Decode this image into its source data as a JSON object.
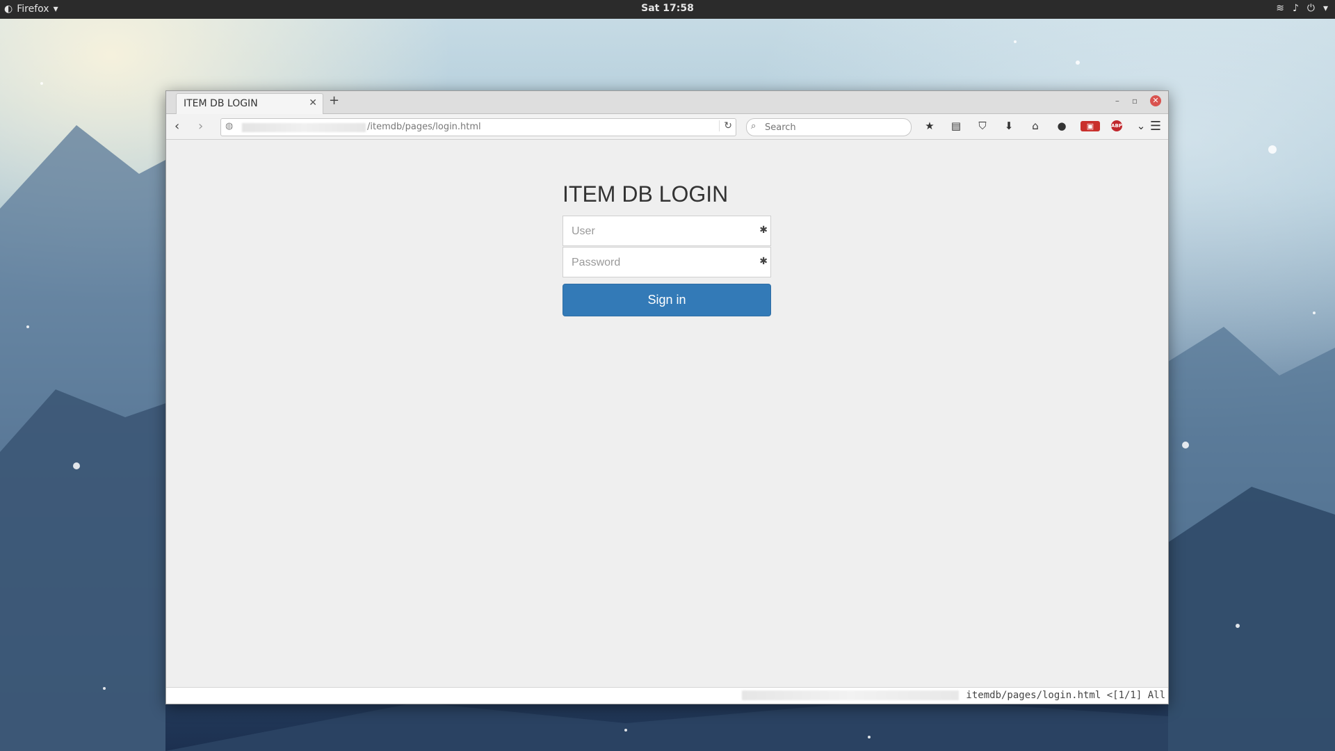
{
  "topbar": {
    "app_name": "Firefox",
    "clock": "Sat 17:58"
  },
  "browser": {
    "tab_title": "ITEM DB LOGIN",
    "url_suffix": "/itemdb/pages/login.html",
    "search_placeholder": "Search",
    "status_text": "itemdb/pages/login.html <[1/1] All"
  },
  "login": {
    "heading": "ITEM DB LOGIN",
    "user_placeholder": "User",
    "password_placeholder": "Password",
    "signin_label": "Sign in"
  },
  "colors": {
    "primary_button": "#337ab7",
    "close_button": "#d9534f"
  },
  "icons": [
    "firefox-icon",
    "wifi-icon",
    "volume-icon",
    "power-icon",
    "back-icon",
    "forward-icon",
    "globe-icon",
    "reload-icon",
    "search-icon",
    "bookmark-star-icon",
    "clipboard-icon",
    "pocket-icon",
    "download-icon",
    "home-icon",
    "chat-icon",
    "extension-icon",
    "adblock-icon",
    "menu-icon",
    "key-icon"
  ]
}
